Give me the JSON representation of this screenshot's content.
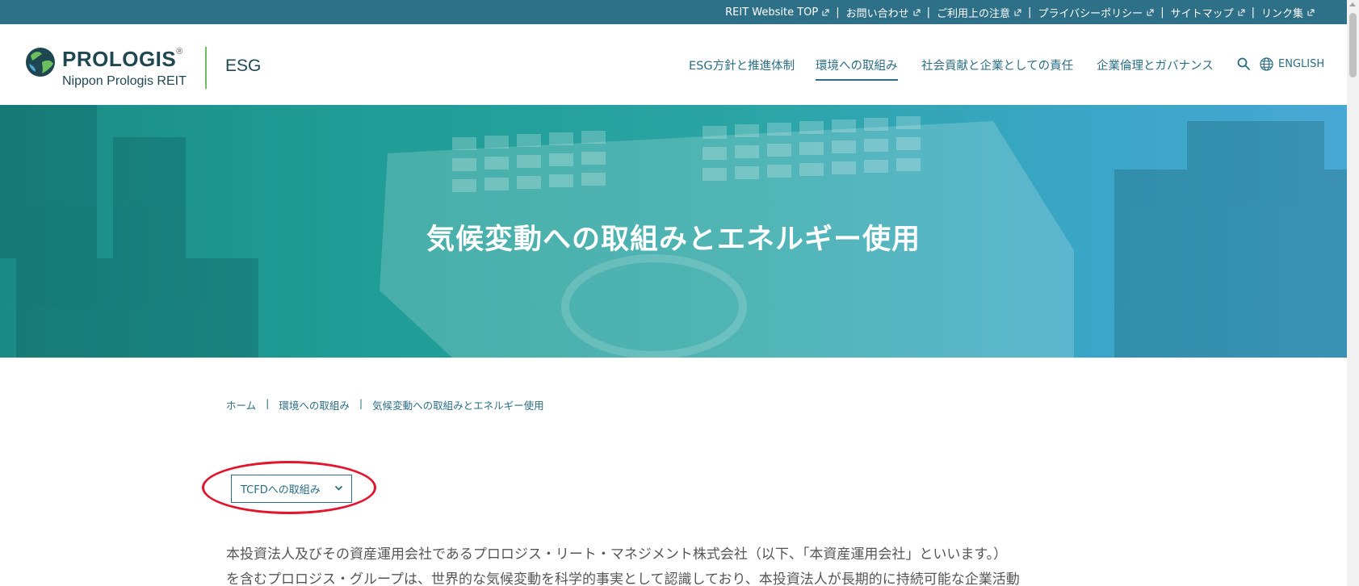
{
  "utility_links": [
    {
      "label": "REIT Website TOP"
    },
    {
      "label": "お問い合わせ"
    },
    {
      "label": "ご利用上の注意"
    },
    {
      "label": "プライバシーポリシー"
    },
    {
      "label": "サイトマップ"
    },
    {
      "label": "リンク集"
    }
  ],
  "utility_separator": "|",
  "logo": {
    "word_pro": "PRO",
    "word_logis": "LOGIS",
    "registered": "®",
    "subtitle": "Nippon Prologis REIT",
    "section": "ESG"
  },
  "nav": {
    "items": [
      {
        "label": "ESG方針と推進体制"
      },
      {
        "label": "環境への取組み"
      },
      {
        "label": "社会貢献と企業としての責任"
      },
      {
        "label": "企業倫理とガバナンス"
      }
    ],
    "active_index": 1,
    "language": "ENGLISH"
  },
  "hero": {
    "title": "気候変動への取組みとエネルギー使用"
  },
  "breadcrumb": {
    "items": [
      {
        "label": "ホーム"
      },
      {
        "label": "環境への取組み"
      },
      {
        "label": "気候変動への取組みとエネルギー使用"
      }
    ],
    "separator": "|"
  },
  "dropdown": {
    "selected": "TCFDへの取組み"
  },
  "body": {
    "lines": [
      "本投資法人及びその資産運用会社であるプロロジス・リート・マネジメント株式会社（以下、「本資産運用会社」といいます。）",
      "を含むプロロジス・グループは、世界的な気候変動を科学的事実として認識しており、本投資法人が長期的に持続可能な企業活動"
    ]
  },
  "colors": {
    "utility_bar": "#2d7088",
    "nav_text": "#2a6d85",
    "logo_accent": "#6cbf5a",
    "highlight": "#e3142b"
  }
}
